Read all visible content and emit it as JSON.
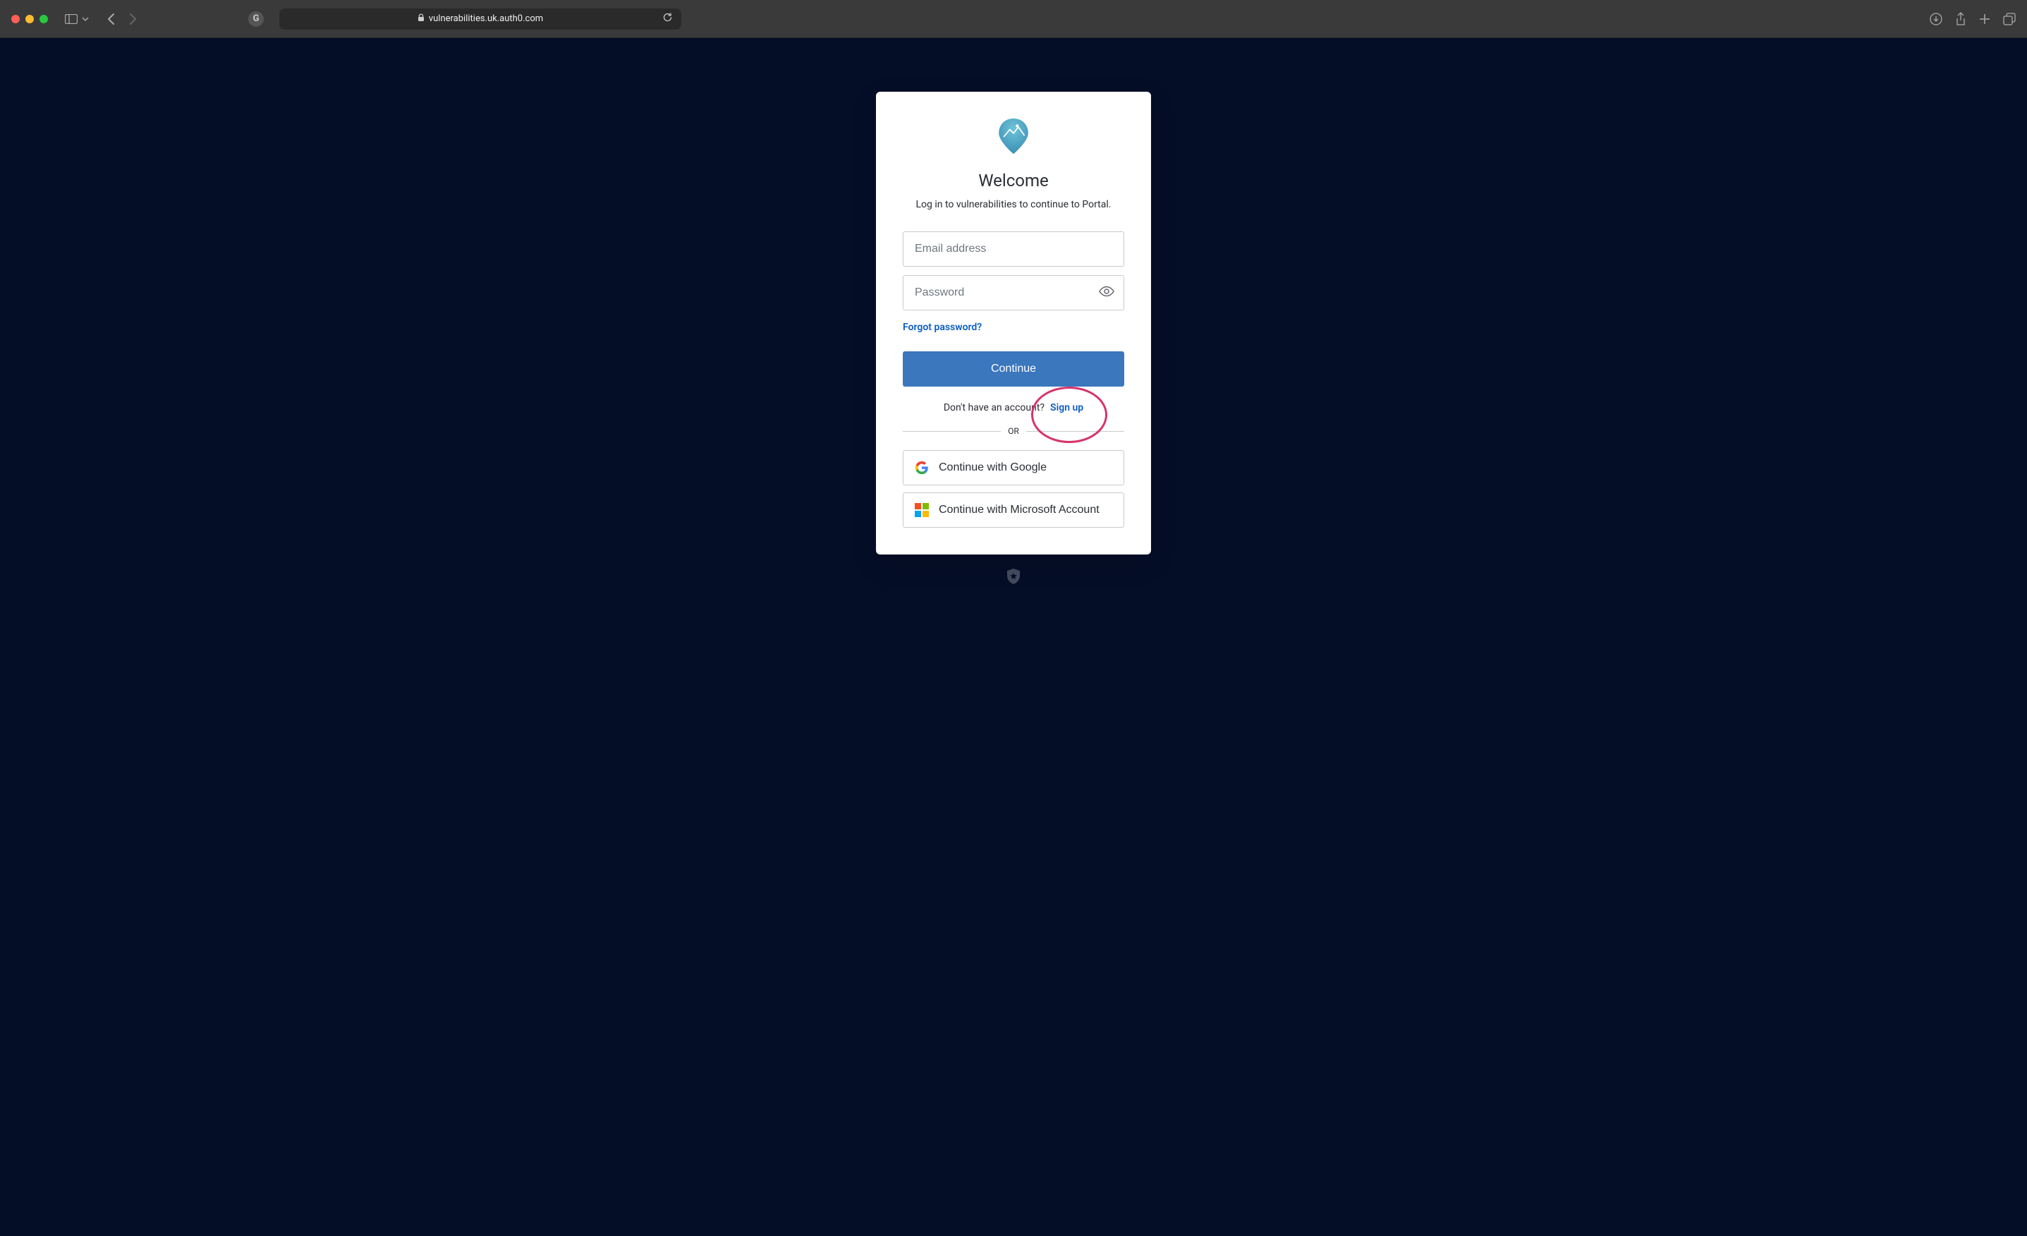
{
  "browser": {
    "url": "vulnerabilities.uk.auth0.com"
  },
  "login": {
    "title": "Welcome",
    "subtitle": "Log in to vulnerabilities to continue to Portal.",
    "email_placeholder": "Email address",
    "password_placeholder": "Password",
    "forgot_password": "Forgot password?",
    "continue_label": "Continue",
    "signup_prompt": "Don't have an account?",
    "signup_link": "Sign up",
    "or_label": "OR",
    "google_label": "Continue with Google",
    "microsoft_label": "Continue with Microsoft Account"
  }
}
